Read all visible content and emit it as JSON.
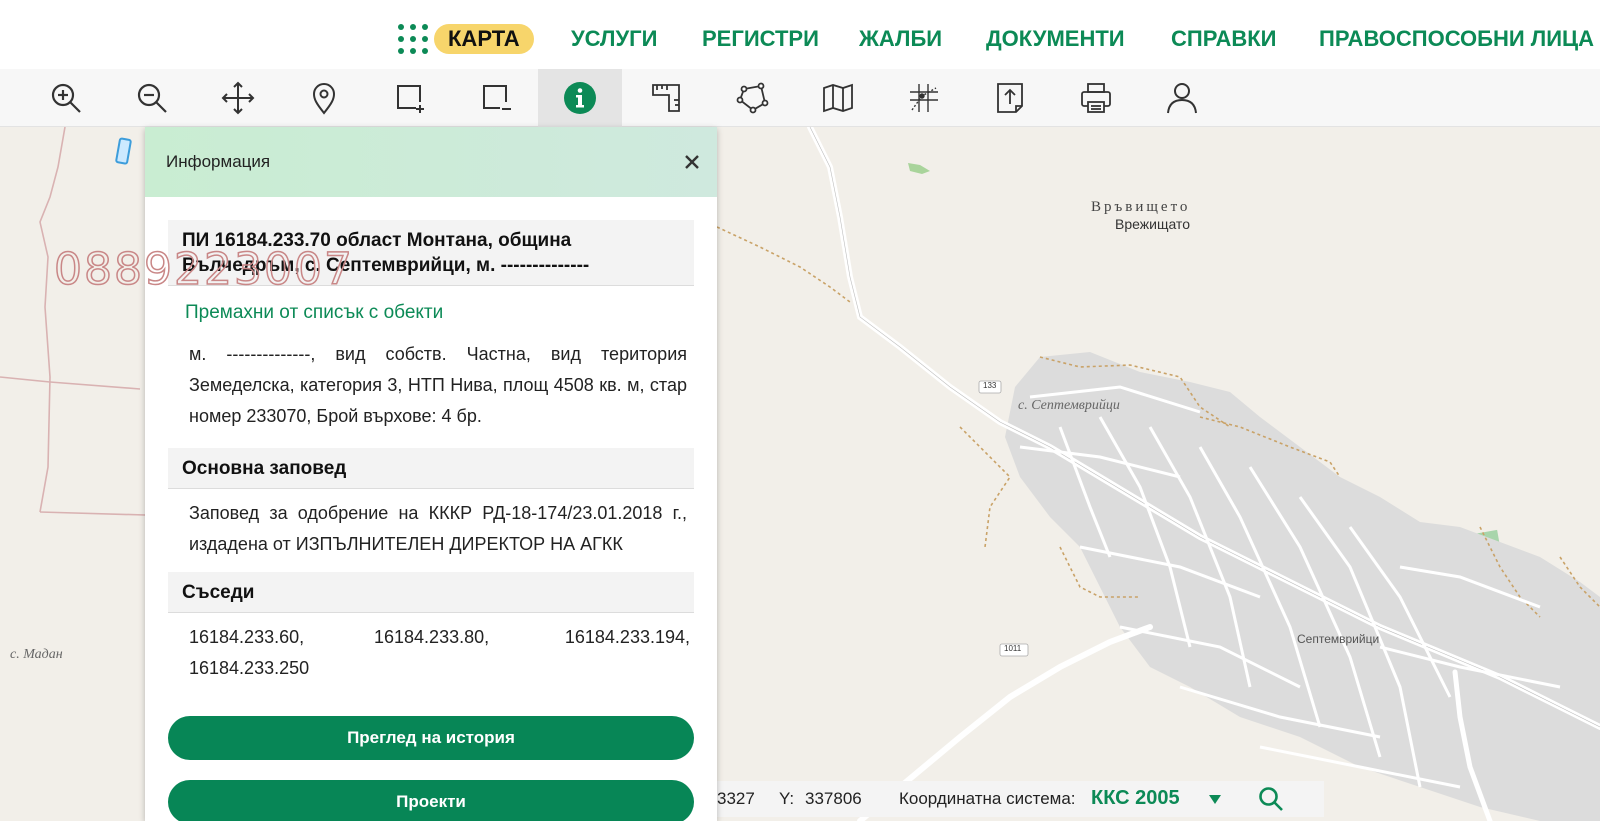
{
  "nav": {
    "items": [
      "КАРТА",
      "УСЛУГИ",
      "РЕГИСТРИ",
      "ЖАЛБИ",
      "ДОКУМЕНТИ",
      "СПРАВКИ",
      "ПРАВОСПОСОБНИ ЛИЦА"
    ],
    "active": "КАРТА"
  },
  "toolbar": {
    "tools": [
      "zoom-in-icon",
      "zoom-out-icon",
      "pan-icon",
      "location-pin-icon",
      "add-area-icon",
      "remove-area-icon",
      "info-icon",
      "measure-icon",
      "polygon-icon",
      "map-icon",
      "gps-grid-icon",
      "upload-document-icon",
      "print-icon",
      "user-icon"
    ],
    "active": "info-icon"
  },
  "colors": {
    "accent": "#0c8a56",
    "active_pill": "#f7d56b",
    "watermark": "#c98787"
  },
  "map": {
    "labels": {
      "vravishteto": "Връвището",
      "vrezhishtato": "Врежищато",
      "septemvriytsi_italic": "с. Септемврийци",
      "septemvriytsi": "Септемврийци",
      "madan": "с. Мадан",
      "road_133": "133",
      "road_1011": "1011"
    },
    "watermark": "0889223007"
  },
  "panel": {
    "title": "Информация",
    "object_heading": "ПИ 16184.233.70 област Монтана, община Вълчедръм, с. Септемврийци, м. --------------",
    "remove_link": "Премахни от списък с обекти",
    "description": "м. --------------, вид собств. Частна, вид територия Земеделска, категория 3, НТП Нива, площ 4508 кв. м, стар номер 233070, Брой върхове: 4 бр.",
    "order_title": "Основна заповед",
    "order_text": "Заповед за одобрение на КККР РД-18-174/23.01.2018 г., издадена от ИЗПЪЛНИТЕЛЕН ДИРЕКТОР НА АГКК",
    "neighbors_title": "Съседи",
    "neighbors": [
      "16184.233.60,",
      "16184.233.80,",
      "16184.233.194,",
      "16184.233.250"
    ],
    "history_button": "Преглед на история",
    "projects_button": "Проекти"
  },
  "coords": {
    "x_value": "3327",
    "y_label": "Y:",
    "y_value": "337806",
    "crs_label": "Координатна система:",
    "crs_value": "ККС 2005"
  }
}
